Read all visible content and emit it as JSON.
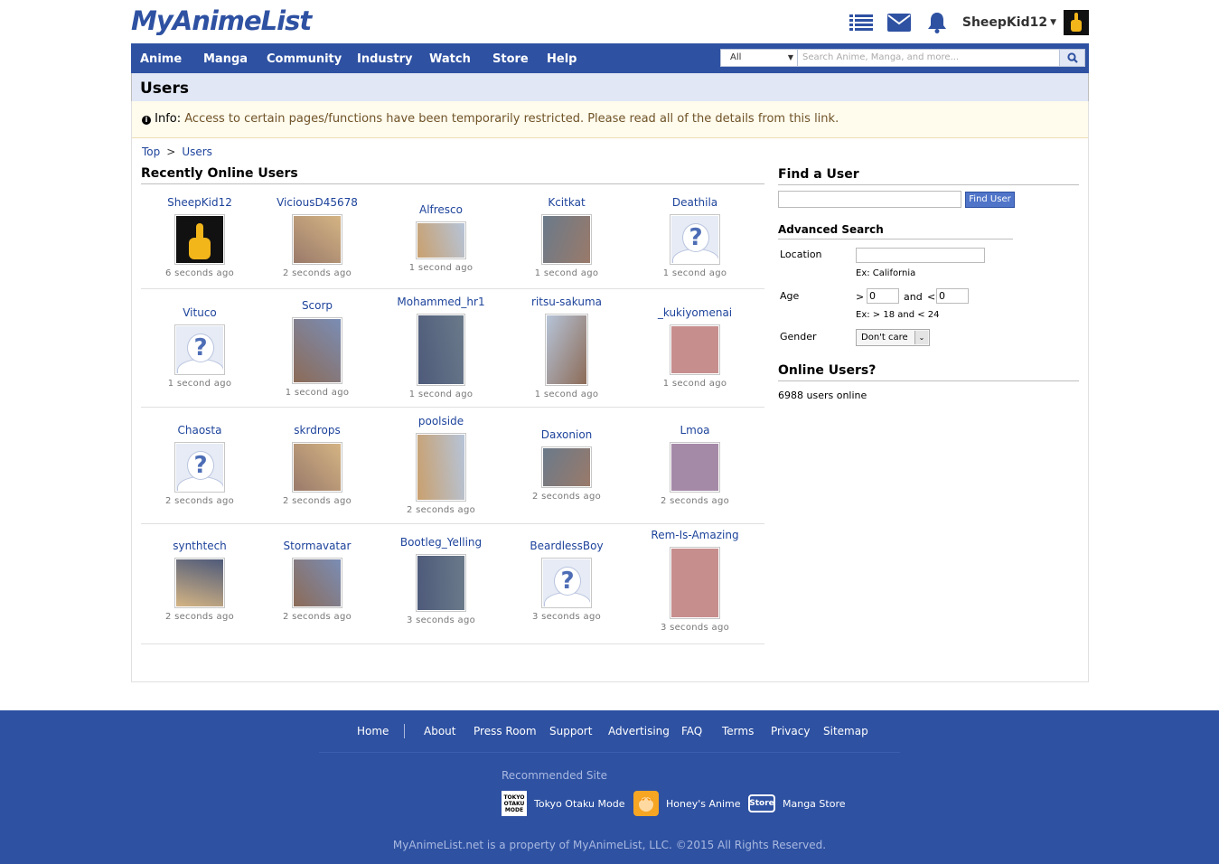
{
  "header": {
    "logo": "MyAnimeList",
    "username": "SheepKid12",
    "icons": [
      "list-icon",
      "mail-icon",
      "bell-icon"
    ]
  },
  "nav": {
    "items": [
      "Anime",
      "Manga",
      "Community",
      "Industry",
      "Watch",
      "Store",
      "Help"
    ],
    "search_category": "All",
    "search_placeholder": "Search Anime, Manga, and more..."
  },
  "page": {
    "title": "Users",
    "info_label": "Info:",
    "info_text": "Access to certain pages/functions have been temporarily restricted. Please read all of the details from this link.",
    "breadcrumb": [
      "Top",
      "Users"
    ],
    "breadcrumb_sep": ">",
    "recent_title": "Recently Online Users"
  },
  "users": [
    {
      "name": "SheepKid12",
      "time": "6 seconds ago",
      "avatar": "hand-avatar"
    },
    {
      "name": "ViciousD45678",
      "time": "2 seconds ago",
      "avatar": "image-avatar"
    },
    {
      "name": "Alfresco",
      "time": "1 second ago",
      "avatar": "image-avatar"
    },
    {
      "name": "Kcitkat",
      "time": "1 second ago",
      "avatar": "image-avatar"
    },
    {
      "name": "Deathila",
      "time": "1 second ago",
      "avatar": "placeholder-avatar"
    },
    {
      "name": "Vituco",
      "time": "1 second ago",
      "avatar": "placeholder-avatar"
    },
    {
      "name": "Scorp",
      "time": "1 second ago",
      "avatar": "image-avatar"
    },
    {
      "name": "Mohammed_hr1",
      "time": "1 second ago",
      "avatar": "image-avatar"
    },
    {
      "name": "ritsu-sakuma",
      "time": "1 second ago",
      "avatar": "image-avatar"
    },
    {
      "name": "_kukiyomenai",
      "time": "1 second ago",
      "avatar": "image-avatar"
    },
    {
      "name": "Chaosta",
      "time": "2 seconds ago",
      "avatar": "placeholder-avatar"
    },
    {
      "name": "skrdrops",
      "time": "2 seconds ago",
      "avatar": "image-avatar"
    },
    {
      "name": "poolside",
      "time": "2 seconds ago",
      "avatar": "image-avatar"
    },
    {
      "name": "Daxonion",
      "time": "2 seconds ago",
      "avatar": "image-avatar"
    },
    {
      "name": "Lmoa",
      "time": "2 seconds ago",
      "avatar": "image-avatar"
    },
    {
      "name": "synthtech",
      "time": "2 seconds ago",
      "avatar": "image-avatar"
    },
    {
      "name": "Stormavatar",
      "time": "2 seconds ago",
      "avatar": "image-avatar"
    },
    {
      "name": "Bootleg_Yelling",
      "time": "3 seconds ago",
      "avatar": "image-avatar"
    },
    {
      "name": "BeardlessBoy",
      "time": "3 seconds ago",
      "avatar": "placeholder-avatar"
    },
    {
      "name": "Rem-Is-Amazing",
      "time": "3 seconds ago",
      "avatar": "image-avatar"
    }
  ],
  "sidebar": {
    "find_title": "Find a User",
    "find_input_value": "",
    "find_button": "Find User",
    "advanced_title": "Advanced Search",
    "location_label": "Location",
    "location_value": "",
    "location_example": "Ex: California",
    "age_label": "Age",
    "age_gt": ">",
    "age_min": "0",
    "age_and": "and",
    "age_lt": "<",
    "age_max": "0",
    "age_example": "Ex: > 18 and < 24",
    "gender_label": "Gender",
    "gender_value": "Don't care",
    "online_title": "Online Users?",
    "online_count": "6988 users online"
  },
  "footer": {
    "links": [
      "Home",
      "About",
      "Press Room",
      "Support",
      "Advertising",
      "FAQ",
      "Terms",
      "Privacy",
      "Sitemap"
    ],
    "recommended_label": "Recommended Site",
    "recommended": [
      "Tokyo Otaku Mode",
      "Honey's Anime",
      "Manga Store"
    ],
    "recommended_icon_text": [
      "TOKYO OTAKU MODE",
      "",
      "Store"
    ],
    "copyright": "MyAnimeList.net is a property of MyAnimeList, LLC. ©2015 All Rights Reserved."
  }
}
